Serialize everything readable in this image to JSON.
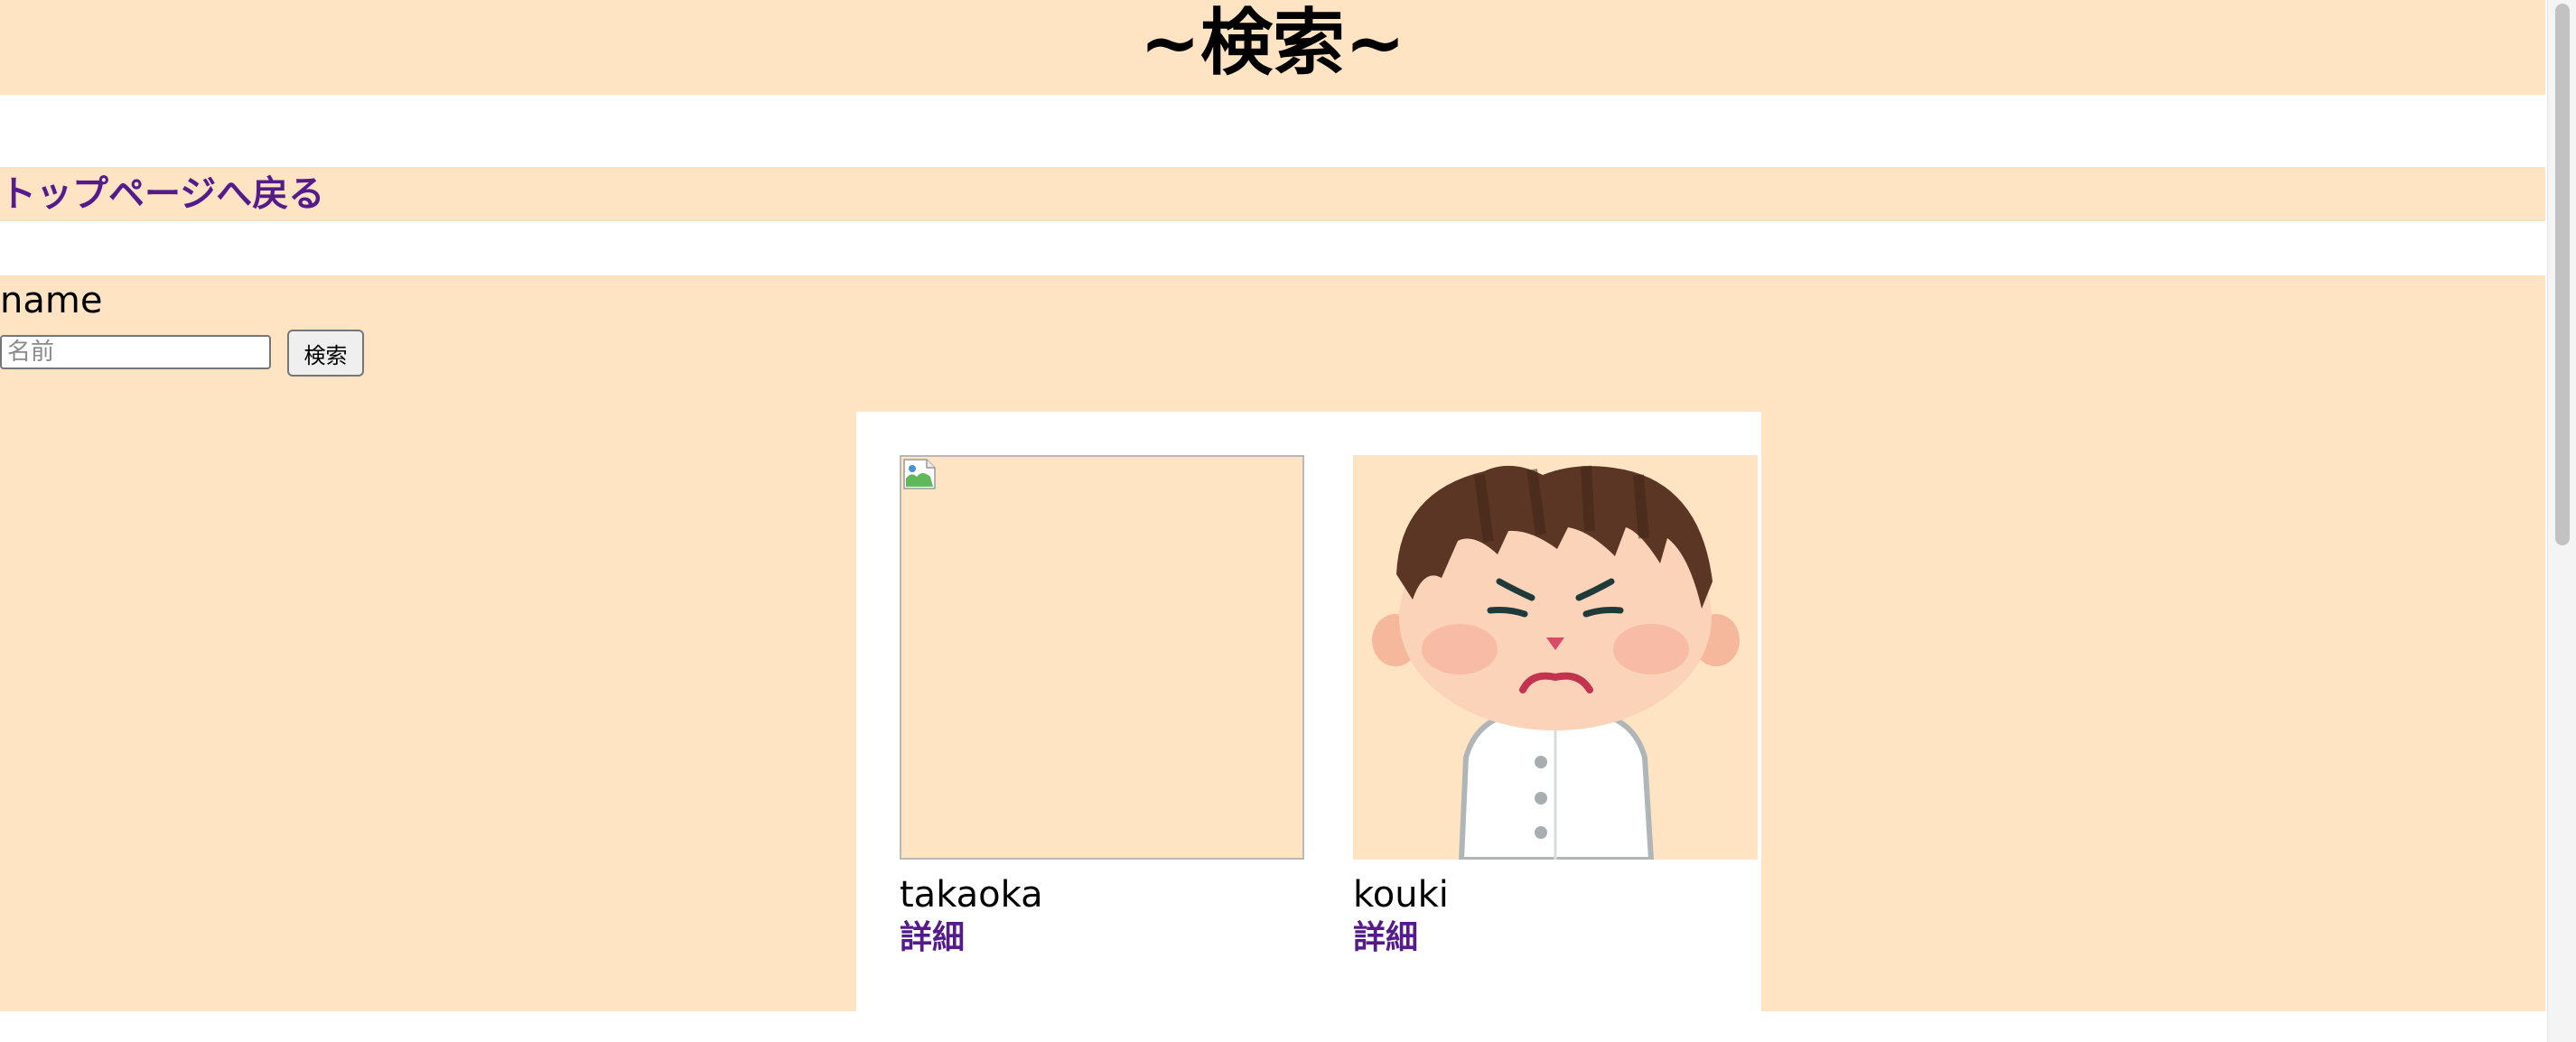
{
  "header": {
    "title": "~検索~"
  },
  "nav": {
    "back_label": "トップページへ戻る"
  },
  "search": {
    "field_label": "name",
    "placeholder": "名前",
    "value": "",
    "button_label": "検索"
  },
  "results": [
    {
      "name": "takaoka",
      "detail_label": "詳細",
      "image": "broken-image"
    },
    {
      "name": "kouki",
      "detail_label": "詳細",
      "image": "frowning-boy-illustration"
    }
  ],
  "colors": {
    "band_background": "#ffe4c4",
    "link": "#551a8b",
    "card_panel": "#ffffff"
  }
}
